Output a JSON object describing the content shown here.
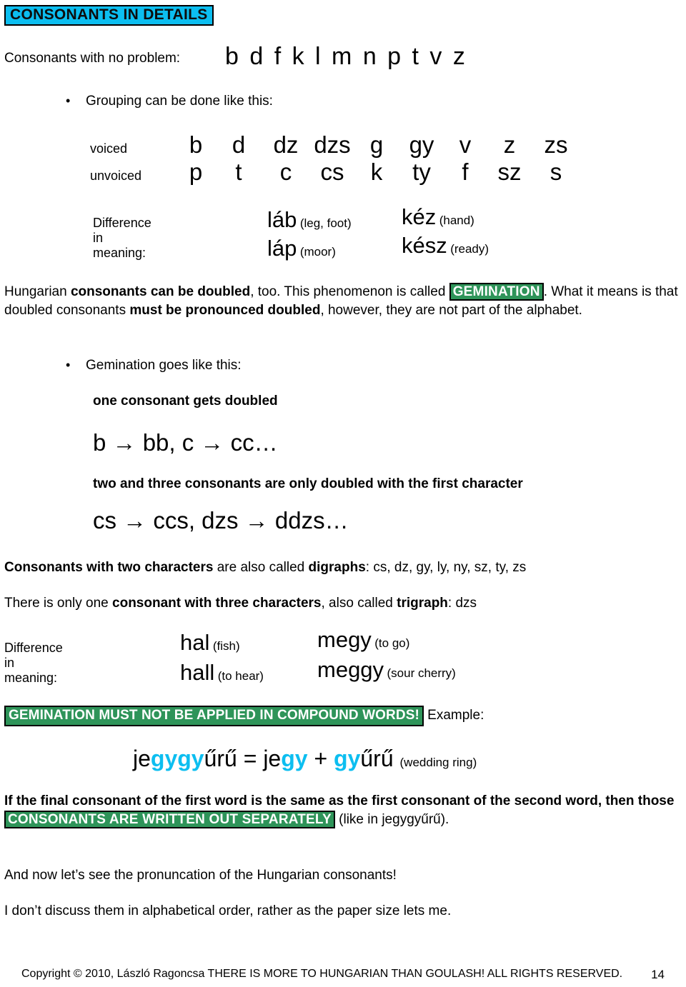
{
  "title": {
    "text": "CONSONANTS IN DETAILS",
    "highlight_color": "#0CBEF0",
    "border_color": "#000000"
  },
  "intro": {
    "label": "Consonants with no problem:",
    "letters": "b d f k l m n p t v z"
  },
  "grouping_bullet": {
    "marker": "•",
    "text": "Grouping can be done like this:"
  },
  "voicing_table": {
    "rows": [
      {
        "label": "voiced",
        "cells": [
          "b",
          "d",
          "dz",
          "dzs",
          "g",
          "gy",
          "v",
          "z",
          "zs"
        ]
      },
      {
        "label": "unvoiced",
        "cells": [
          "p",
          "t",
          "c",
          "cs",
          "k",
          "ty",
          "f",
          "sz",
          "s"
        ]
      }
    ]
  },
  "meaning_one": {
    "label": "Difference in meaning:",
    "pairs": [
      {
        "word": "láb",
        "gloss": "(leg, foot)"
      },
      {
        "word": "kéz",
        "gloss": "(hand)"
      },
      {
        "word": "láp",
        "gloss": "(moor)"
      },
      {
        "word": "kész",
        "gloss": "(ready)"
      }
    ]
  },
  "gemination_para": {
    "seg1": "Hungarian ",
    "bold1": "consonants can be doubled",
    "seg2": ", too. This phenomenon is called ",
    "highlight": "GEMINATION",
    "seg3": ". What it means is that doubled consonants ",
    "bold2": "must be pronounced doubled",
    "seg4": ", however, they are not part of the alphabet."
  },
  "gemination_bullet": {
    "marker": "•",
    "text": "Gemination goes like this:"
  },
  "rule_one": {
    "heading": "one consonant gets doubled",
    "example": "b → bb, c → cc…"
  },
  "rule_two": {
    "heading": "two and three consonants are only doubled with the first character",
    "example": "cs → ccs, dzs → ddzs…"
  },
  "digraph_para": {
    "bold1": "Consonants with two characters",
    "seg1": " are also called ",
    "bold2": "digraphs",
    "seg2": ": cs, dz, gy, ly, ny, sz, ty, zs"
  },
  "trigraph_para": {
    "seg1": "There is only one ",
    "bold1": "consonant with three characters",
    "seg2": ", also called ",
    "bold2": "trigraph",
    "seg3": ": dzs"
  },
  "meaning_two": {
    "label": "Difference in meaning:",
    "pairs": [
      {
        "word": "hal",
        "gloss": "(fish)"
      },
      {
        "word": "megy",
        "gloss": "(to go)"
      },
      {
        "word": "hall",
        "gloss": "(to hear)"
      },
      {
        "word": "meggy",
        "gloss": "(sour cherry)"
      }
    ]
  },
  "compound_warning": {
    "highlight": "GEMINATION MUST NOT BE APPLIED IN COMPOUND WORDS!",
    "after": " Example:",
    "highlight_color": "#2E9459"
  },
  "compound_example": {
    "p1": "je",
    "c1": "gygy",
    "p2": "űrű = je",
    "c2": "gy",
    "p3": " + ",
    "c3": "gy",
    "p4": "űrű ",
    "gloss": "(wedding ring)",
    "accent_color": "#0CBEF0"
  },
  "final_rule": {
    "bold1": "If the final consonant of the first word is the same as the first consonant of the second word, then those ",
    "highlight": "CONSONANTS ARE WRITTEN OUT SEPARATELY",
    "after": " (like in jegygyűrű)."
  },
  "closing": {
    "line1": "And now let’s see the pronuncation of the Hungarian consonants!",
    "line2": "I don’t discuss them in alphabetical order, rather as the paper size lets me."
  },
  "footer": {
    "copyright": "Copyright © 2010, László Ragoncsa THERE IS MORE TO HUNGARIAN THAN GOULASH! ALL RIGHTS RESERVED.",
    "page_number": "14"
  }
}
